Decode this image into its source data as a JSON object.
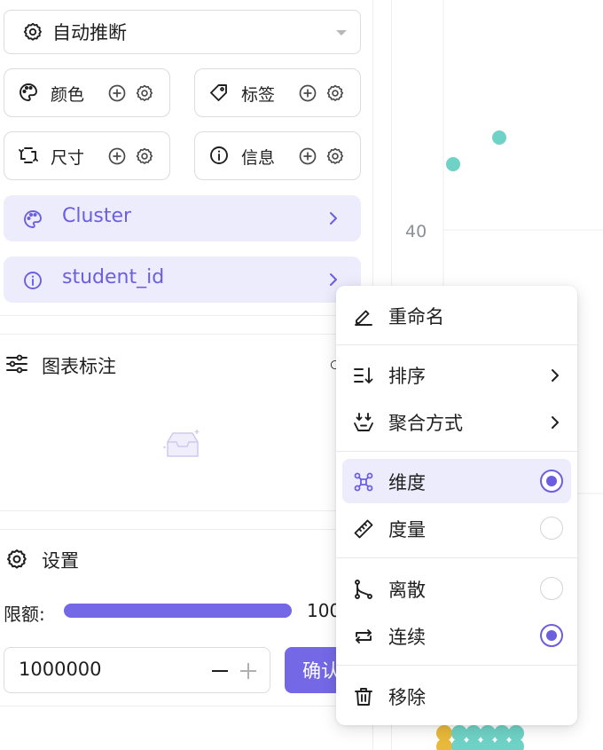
{
  "encoding": {
    "infer_select": {
      "label": "自动推断",
      "icon": "gear-icon"
    },
    "buttons": [
      {
        "key": "color",
        "label": "颜色",
        "icon": "palette-icon"
      },
      {
        "key": "label",
        "label": "标签",
        "icon": "tag-icon"
      },
      {
        "key": "size",
        "label": "尺寸",
        "icon": "resize-icon"
      },
      {
        "key": "info",
        "label": "信息",
        "icon": "info-icon"
      }
    ],
    "fields": [
      {
        "name": "Cluster",
        "icon": "palette-icon"
      },
      {
        "name": "student_id",
        "icon": "info-icon"
      }
    ]
  },
  "annotations": {
    "title": "图表标注",
    "icon": "sliders-icon",
    "empty_icon": "empty-inbox-icon"
  },
  "settings": {
    "title": "设置",
    "limit_label": "限额:",
    "limit_value": "100",
    "limit_fill": 1.0,
    "input_value": "1000000",
    "confirm_label": "确认"
  },
  "chart": {
    "tick_label": "40",
    "accent_teal": "#6fd2c6",
    "accent_yellow": "#e8b93a"
  },
  "context_menu": {
    "rename": "重命名",
    "sort": "排序",
    "aggregate": "聚合方式",
    "dimension": "维度",
    "measure": "度量",
    "discrete": "离散",
    "continuous": "连续",
    "remove": "移除",
    "selected_type": "dimension",
    "selected_scale": "continuous"
  },
  "colors": {
    "accent": "#6b5fe0",
    "accent_bg": "#ececfc"
  }
}
